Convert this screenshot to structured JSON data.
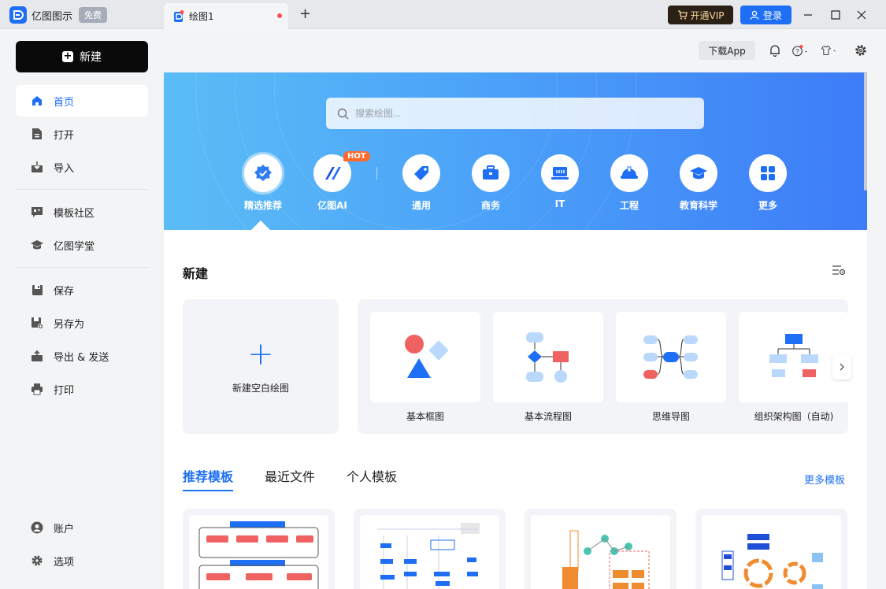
{
  "titlebar": {
    "app_name": "亿图图示",
    "free_badge": "免费",
    "doc_tab": "绘图1",
    "add_tab": "+",
    "close_tab": "×",
    "vip_label": "开通VIP",
    "login_label": "登录"
  },
  "sidebar": {
    "new_label": "新建",
    "items": [
      {
        "label": "首页",
        "icon": "home-icon"
      },
      {
        "label": "打开",
        "icon": "file-icon"
      },
      {
        "label": "导入",
        "icon": "import-icon"
      },
      {
        "label": "模板社区",
        "icon": "community-icon"
      },
      {
        "label": "亿图学堂",
        "icon": "academy-icon"
      },
      {
        "label": "保存",
        "icon": "save-icon"
      },
      {
        "label": "另存为",
        "icon": "save-as-icon"
      },
      {
        "label": "导出 & 发送",
        "icon": "export-icon"
      },
      {
        "label": "打印",
        "icon": "print-icon"
      },
      {
        "label": "账户",
        "icon": "account-icon"
      },
      {
        "label": "选项",
        "icon": "settings-icon"
      }
    ]
  },
  "toolbar": {
    "download_app": "下载App"
  },
  "search": {
    "placeholder": "搜索绘图..."
  },
  "categories": [
    {
      "label": "精选推荐",
      "icon": "featured-icon"
    },
    {
      "label": "亿图AI",
      "icon": "ai-icon",
      "badge": "HOT"
    },
    {
      "label": "通用",
      "icon": "tag-icon"
    },
    {
      "label": "商务",
      "icon": "briefcase-icon"
    },
    {
      "label": "IT",
      "icon": "laptop-icon"
    },
    {
      "label": "工程",
      "icon": "helmet-icon"
    },
    {
      "label": "教育科学",
      "icon": "graduation-cap-icon"
    },
    {
      "label": "更多",
      "icon": "grid-icon"
    }
  ],
  "new_section": {
    "title": "新建",
    "blank_label": "新建空白绘图",
    "templates": [
      {
        "label": "基本框图"
      },
      {
        "label": "基本流程图"
      },
      {
        "label": "思维导图"
      },
      {
        "label": "组织架构图（自动)"
      }
    ]
  },
  "bottom_tabs": {
    "tabs": [
      "推荐模板",
      "最近文件",
      "个人模板"
    ],
    "more": "更多模板"
  },
  "colors": {
    "accent": "#1e6ff5",
    "hot": "#ff6a2c"
  }
}
